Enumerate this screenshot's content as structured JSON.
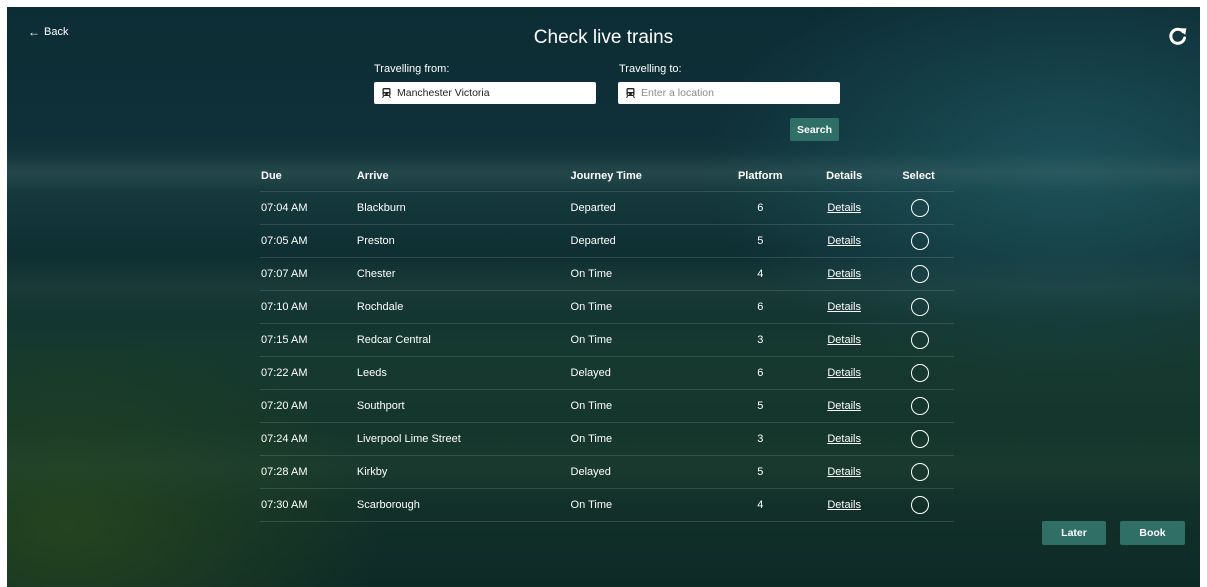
{
  "nav": {
    "back_label": "Back"
  },
  "title": "Check live trains",
  "search": {
    "from_label": "Travelling from:",
    "from_value": "Manchester Victoria",
    "to_label": "Travelling to:",
    "to_placeholder": "Enter a location",
    "button_label": "Search"
  },
  "table": {
    "headers": {
      "due": "Due",
      "arrive": "Arrive",
      "journey_time": "Journey Time",
      "platform": "Platform",
      "details": "Details",
      "select": "Select"
    },
    "rows": [
      {
        "due": "07:04 AM",
        "arrive": "Blackburn",
        "status": "Departed",
        "platform": "6",
        "details": "Details"
      },
      {
        "due": "07:05 AM",
        "arrive": "Preston",
        "status": "Departed",
        "platform": "5",
        "details": "Details"
      },
      {
        "due": "07:07 AM",
        "arrive": "Chester",
        "status": "On Time",
        "platform": "4",
        "details": "Details"
      },
      {
        "due": "07:10 AM",
        "arrive": "Rochdale",
        "status": "On Time",
        "platform": "6",
        "details": "Details"
      },
      {
        "due": "07:15 AM",
        "arrive": "Redcar Central",
        "status": "On Time",
        "platform": "3",
        "details": "Details"
      },
      {
        "due": "07:22 AM",
        "arrive": "Leeds",
        "status": "Delayed",
        "platform": "6",
        "details": "Details"
      },
      {
        "due": "07:20 AM",
        "arrive": "Southport",
        "status": "On Time",
        "platform": "5",
        "details": "Details"
      },
      {
        "due": "07:24 AM",
        "arrive": "Liverpool Lime Street",
        "status": "On Time",
        "platform": "3",
        "details": "Details"
      },
      {
        "due": "07:28 AM",
        "arrive": "Kirkby",
        "status": "Delayed",
        "platform": "5",
        "details": "Details"
      },
      {
        "due": "07:30 AM",
        "arrive": "Scarborough",
        "status": "On Time",
        "platform": "4",
        "details": "Details"
      }
    ]
  },
  "actions": {
    "later_label": "Later",
    "book_label": "Book"
  },
  "colors": {
    "accent": "#2f6f66",
    "text": "#ffffff"
  },
  "icons": {
    "back": "arrow-left-icon",
    "refresh": "refresh-icon",
    "train": "train-icon",
    "select": "radio-circle-icon"
  }
}
